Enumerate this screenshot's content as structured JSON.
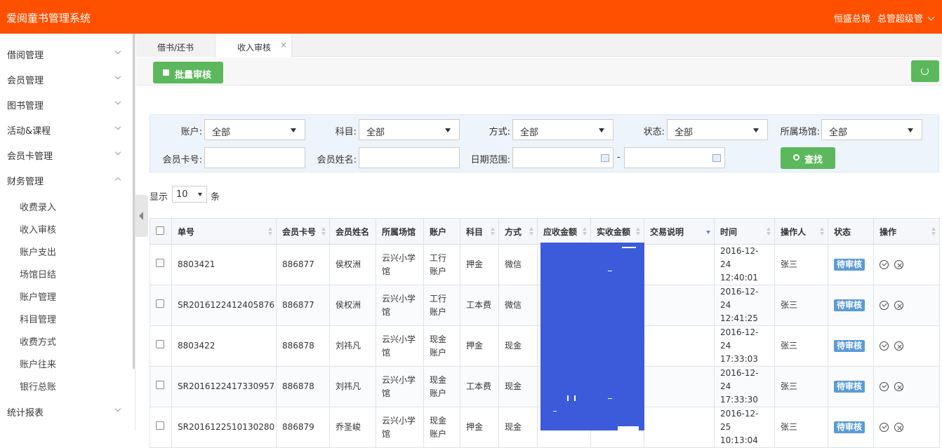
{
  "header": {
    "brand": "爱阅童书管理系统",
    "venue": "恒盛总馆",
    "user": "总管超级管"
  },
  "sidebar": {
    "menus": [
      {
        "label": "借阅管理"
      },
      {
        "label": "会员管理"
      },
      {
        "label": "图书管理"
      },
      {
        "label": "活动&课程"
      },
      {
        "label": "会员卡管理"
      },
      {
        "label": "财务管理"
      }
    ],
    "finance_sub": [
      "收费录入",
      "收入审核",
      "账户支出",
      "场馆日结",
      "账户管理",
      "科目管理",
      "收费方式",
      "账户往来",
      "银行总账"
    ],
    "bottom_menu": "统计报表"
  },
  "tabs": [
    {
      "label": "借书/还书"
    },
    {
      "label": "收入审核",
      "close": "×"
    }
  ],
  "toolbar": {
    "batch_label": "批量审核"
  },
  "filter": {
    "account_label": "账户:",
    "account_value": "全部",
    "subject_label": "科目:",
    "subject_value": "全部",
    "method_label": "方式:",
    "method_value": "全部",
    "status_label": "状态:",
    "status_value": "全部",
    "venue_label": "所属场馆:",
    "venue_value": "全部",
    "card_label": "会员卡号:",
    "name_label": "会员姓名:",
    "date_label": "日期范围:",
    "date_sep": "-",
    "search_label": "查找"
  },
  "pager": {
    "prefix": "显示",
    "size": "10",
    "suffix": "条"
  },
  "table": {
    "headers": [
      "单号",
      "会员卡号",
      "会员姓名",
      "所属场馆",
      "账户",
      "科目",
      "方式",
      "应收金额",
      "实收金额",
      "交易说明",
      "时间",
      "操作人",
      "状态",
      "操作"
    ],
    "rows": [
      {
        "no": "8803421",
        "card": "886877",
        "name": "侯权洲",
        "venue": "云兴小学馆",
        "account": "工行账户",
        "subject": "押金",
        "method": "微信",
        "due": "",
        "paid": "",
        "note": "",
        "date": "2016-12-24",
        "time": "12:40:01",
        "op": "张三",
        "status": "待审核"
      },
      {
        "no": "SR2016122412405876",
        "card": "886877",
        "name": "侯权洲",
        "venue": "云兴小学馆",
        "account": "工行账户",
        "subject": "工本费",
        "method": "微信",
        "due": "",
        "paid": "",
        "note": "",
        "date": "2016-12-24",
        "time": "12:41:25",
        "op": "张三",
        "status": "待审核"
      },
      {
        "no": "8803422",
        "card": "886878",
        "name": "刘祎凡",
        "venue": "云兴小学馆",
        "account": "现金账户",
        "subject": "押金",
        "method": "现金",
        "due": "",
        "paid": "",
        "note": "",
        "date": "2016-12-24",
        "time": "17:33:03",
        "op": "张三",
        "status": "待审核"
      },
      {
        "no": "SR2016122417330957",
        "card": "886878",
        "name": "刘祎凡",
        "venue": "云兴小学馆",
        "account": "现金账户",
        "subject": "工本费",
        "method": "现金",
        "due": "",
        "paid": "",
        "note": "",
        "date": "2016-12-24",
        "time": "17:33:30",
        "op": "张三",
        "status": "待审核"
      },
      {
        "no": "SR2016122510130280",
        "card": "886879",
        "name": "乔圣峻",
        "venue": "云兴小学馆",
        "account": "现金账户",
        "subject": "押金",
        "method": "现金",
        "due": "",
        "paid": "",
        "note": "",
        "date": "2016-12-25",
        "time": "10:13:04",
        "op": "张三",
        "status": "待审核"
      }
    ]
  },
  "colors": {
    "header": "#ff5000",
    "button": "#5cb85c",
    "badge": "#5b9bd5",
    "redaction": "#3b5bdb"
  }
}
